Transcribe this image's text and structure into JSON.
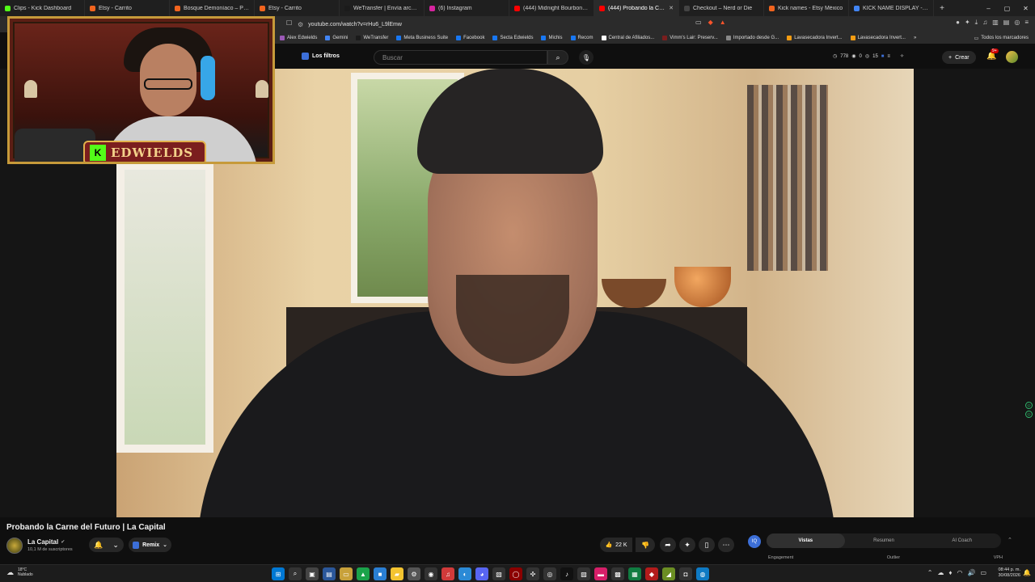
{
  "browser": {
    "tabs": [
      {
        "label": "Clips - Kick Dashboard",
        "color": "#53fc18",
        "active": false
      },
      {
        "label": "Etsy - Carrito",
        "color": "#f1641e",
        "active": false
      },
      {
        "label": "Bosque Demoníaco – Paquete",
        "color": "#f1641e",
        "active": false
      },
      {
        "label": "Etsy - Carrito",
        "color": "#f1641e",
        "active": false
      },
      {
        "label": "WeTransfer | Envía archivos gr",
        "color": "#1b1b1b",
        "active": false
      },
      {
        "label": "(6) Instagram",
        "color": "#d6249f",
        "active": false
      },
      {
        "label": "(444) Midnight Bourbon - 3 H",
        "color": "#ff0000",
        "active": false
      },
      {
        "label": "(444) Probando la Carn",
        "color": "#ff0000",
        "active": true
      },
      {
        "label": "Checkout – Nerd or Die",
        "color": "#444444",
        "active": false
      },
      {
        "label": "Kick names - Etsy México",
        "color": "#f1641e",
        "active": false
      },
      {
        "label": "KICK NAME DISPLAY - Buscar",
        "color": "#4285f4",
        "active": false
      }
    ],
    "new_tab": "+",
    "window_controls": {
      "minimize": "–",
      "maximize": "▢",
      "close": "✕"
    },
    "url": "youtube.com/watch?v=rHu6_L9lEmw",
    "bookmarks": [
      {
        "label": "Alex Edwields",
        "color": "#9b59b6"
      },
      {
        "label": "Gemini",
        "color": "#4285f4"
      },
      {
        "label": "WeTransfer",
        "color": "#1b1b1b"
      },
      {
        "label": "Meta Business Suite",
        "color": "#1877f2"
      },
      {
        "label": "Facebook",
        "color": "#1877f2"
      },
      {
        "label": "Secta Edwields",
        "color": "#1877f2"
      },
      {
        "label": "Michis",
        "color": "#1877f2"
      },
      {
        "label": "Recom",
        "color": "#1877f2"
      },
      {
        "label": "Central de Afiliados...",
        "color": "#ffffff"
      },
      {
        "label": "Vimm's Lair: Preserv...",
        "color": "#7a1e1e"
      },
      {
        "label": "Importado desde G...",
        "color": "#888888"
      },
      {
        "label": "Lavasecadora Invert...",
        "color": "#f39c12"
      },
      {
        "label": "Lavasecadora Invert...",
        "color": "#f39c12"
      }
    ],
    "all_bookmarks": "Todos los marcadores"
  },
  "youtube": {
    "filters_label": "Los filtros",
    "search_placeholder": "Buscar",
    "stats": {
      "views": "778",
      "a": "0",
      "b": "15"
    },
    "create_label": "Crear",
    "notif_badge": "9+"
  },
  "webcam": {
    "logo_text": "EDWIELDS",
    "logo_k": "K"
  },
  "video": {
    "title": "Probando la Carne del Futuro | La Capital",
    "channel": "La Capital",
    "subscribers": "10,1 M de suscriptores",
    "remix_label": "Remix",
    "likes": "22 K"
  },
  "panel": {
    "logo": "IQ",
    "tabs": [
      {
        "label": "Vistas",
        "active": true
      },
      {
        "label": "Resumen",
        "active": false
      },
      {
        "label": "AI Coach",
        "active": false
      }
    ],
    "columns": [
      "Engagement",
      "Outlier",
      "VPH"
    ]
  },
  "taskbar": {
    "temp": "18°C",
    "weather": "Nublado",
    "time": "08:44 p. m.",
    "date": "30/08/2026"
  }
}
